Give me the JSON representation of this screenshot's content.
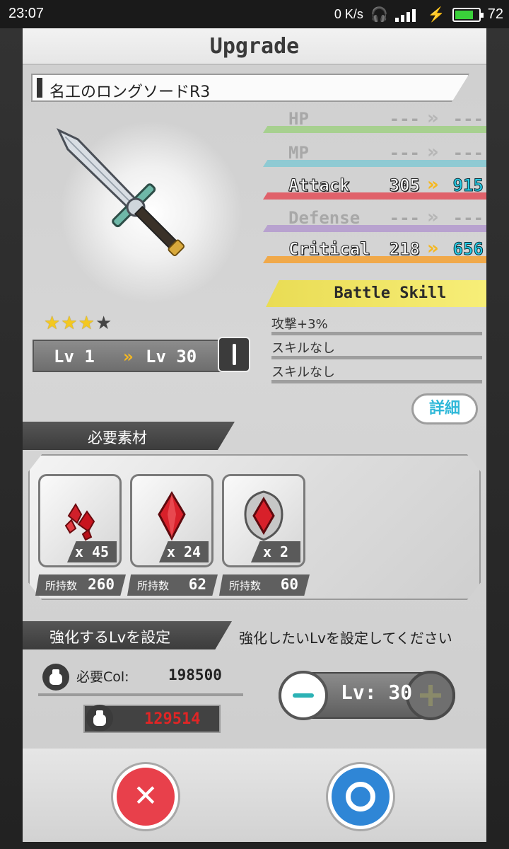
{
  "status_bar": {
    "time": "23:07",
    "net_speed": "0 K/s",
    "network": "4G",
    "battery": "72"
  },
  "title": "Upgrade",
  "item_name": "名工のロングソードR3",
  "rarity": {
    "stars_on": "★★★",
    "stars_off": "★"
  },
  "level": {
    "from_label": "Lv  1",
    "arrow": "»",
    "to_label": "Lv  30"
  },
  "stats": [
    {
      "name": "HP",
      "current": "---",
      "arrow": "»",
      "new": "---",
      "active": false,
      "color": "#a7d08f"
    },
    {
      "name": "MP",
      "current": "---",
      "arrow": "»",
      "new": "---",
      "active": false,
      "color": "#8fcad3"
    },
    {
      "name": "Attack",
      "current": "305",
      "arrow": "»",
      "new": "915",
      "active": true,
      "color": "#e0616a"
    },
    {
      "name": "Defense",
      "current": "---",
      "arrow": "»",
      "new": "---",
      "active": false,
      "color": "#b8a2cf"
    },
    {
      "name": "Critical",
      "current": "218",
      "arrow": "»",
      "new": "656",
      "active": true,
      "color": "#f0a94a"
    }
  ],
  "battle_skill": {
    "label": "Battle Skill",
    "skills": [
      "攻撃+3%",
      "スキルなし",
      "スキルなし"
    ],
    "detail_button": "詳細"
  },
  "materials": {
    "header": "必要素材",
    "items": [
      {
        "name": "red-crystal-shards",
        "required": "x 45",
        "owned_label": "所持数",
        "owned": "260"
      },
      {
        "name": "red-gem",
        "required": "x 24",
        "owned_label": "所持数",
        "owned": "62"
      },
      {
        "name": "ornate-red-gem",
        "required": "x 2",
        "owned_label": "所持数",
        "owned": "60"
      }
    ]
  },
  "level_set": {
    "header": "強化するLvを設定",
    "hint": "強化したいLvを設定してください",
    "cost_label": "必要Col:",
    "cost_value": "198500",
    "owned_col": "129514",
    "level_display": "Lv: 30"
  },
  "buttons": {
    "cancel": "✕",
    "confirm": "○"
  }
}
